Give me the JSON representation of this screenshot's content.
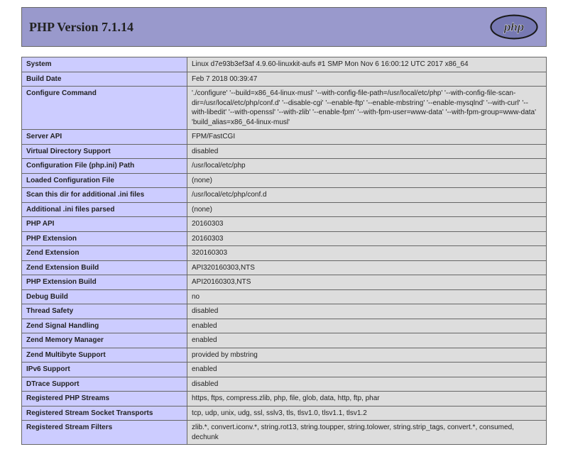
{
  "header": {
    "title": "PHP Version 7.1.14"
  },
  "rows": [
    {
      "k": "System",
      "v": "Linux d7e93b3ef3af 4.9.60-linuxkit-aufs #1 SMP Mon Nov 6 16:00:12 UTC 2017 x86_64"
    },
    {
      "k": "Build Date",
      "v": "Feb 7 2018 00:39:47"
    },
    {
      "k": "Configure Command",
      "v": "'./configure' '--build=x86_64-linux-musl' '--with-config-file-path=/usr/local/etc/php' '--with-config-file-scan-dir=/usr/local/etc/php/conf.d' '--disable-cgi' '--enable-ftp' '--enable-mbstring' '--enable-mysqlnd' '--with-curl' '--with-libedit' '--with-openssl' '--with-zlib' '--enable-fpm' '--with-fpm-user=www-data' '--with-fpm-group=www-data' 'build_alias=x86_64-linux-musl'"
    },
    {
      "k": "Server API",
      "v": "FPM/FastCGI"
    },
    {
      "k": "Virtual Directory Support",
      "v": "disabled"
    },
    {
      "k": "Configuration File (php.ini) Path",
      "v": "/usr/local/etc/php"
    },
    {
      "k": "Loaded Configuration File",
      "v": "(none)"
    },
    {
      "k": "Scan this dir for additional .ini files",
      "v": "/usr/local/etc/php/conf.d"
    },
    {
      "k": "Additional .ini files parsed",
      "v": "(none)"
    },
    {
      "k": "PHP API",
      "v": "20160303"
    },
    {
      "k": "PHP Extension",
      "v": "20160303"
    },
    {
      "k": "Zend Extension",
      "v": "320160303"
    },
    {
      "k": "Zend Extension Build",
      "v": "API320160303,NTS"
    },
    {
      "k": "PHP Extension Build",
      "v": "API20160303,NTS"
    },
    {
      "k": "Debug Build",
      "v": "no"
    },
    {
      "k": "Thread Safety",
      "v": "disabled"
    },
    {
      "k": "Zend Signal Handling",
      "v": "enabled"
    },
    {
      "k": "Zend Memory Manager",
      "v": "enabled"
    },
    {
      "k": "Zend Multibyte Support",
      "v": "provided by mbstring"
    },
    {
      "k": "IPv6 Support",
      "v": "enabled"
    },
    {
      "k": "DTrace Support",
      "v": "disabled"
    },
    {
      "k": "Registered PHP Streams",
      "v": "https, ftps, compress.zlib, php, file, glob, data, http, ftp, phar"
    },
    {
      "k": "Registered Stream Socket Transports",
      "v": "tcp, udp, unix, udg, ssl, sslv3, tls, tlsv1.0, tlsv1.1, tlsv1.2"
    },
    {
      "k": "Registered Stream Filters",
      "v": "zlib.*, convert.iconv.*, string.rot13, string.toupper, string.tolower, string.strip_tags, convert.*, consumed, dechunk"
    }
  ]
}
